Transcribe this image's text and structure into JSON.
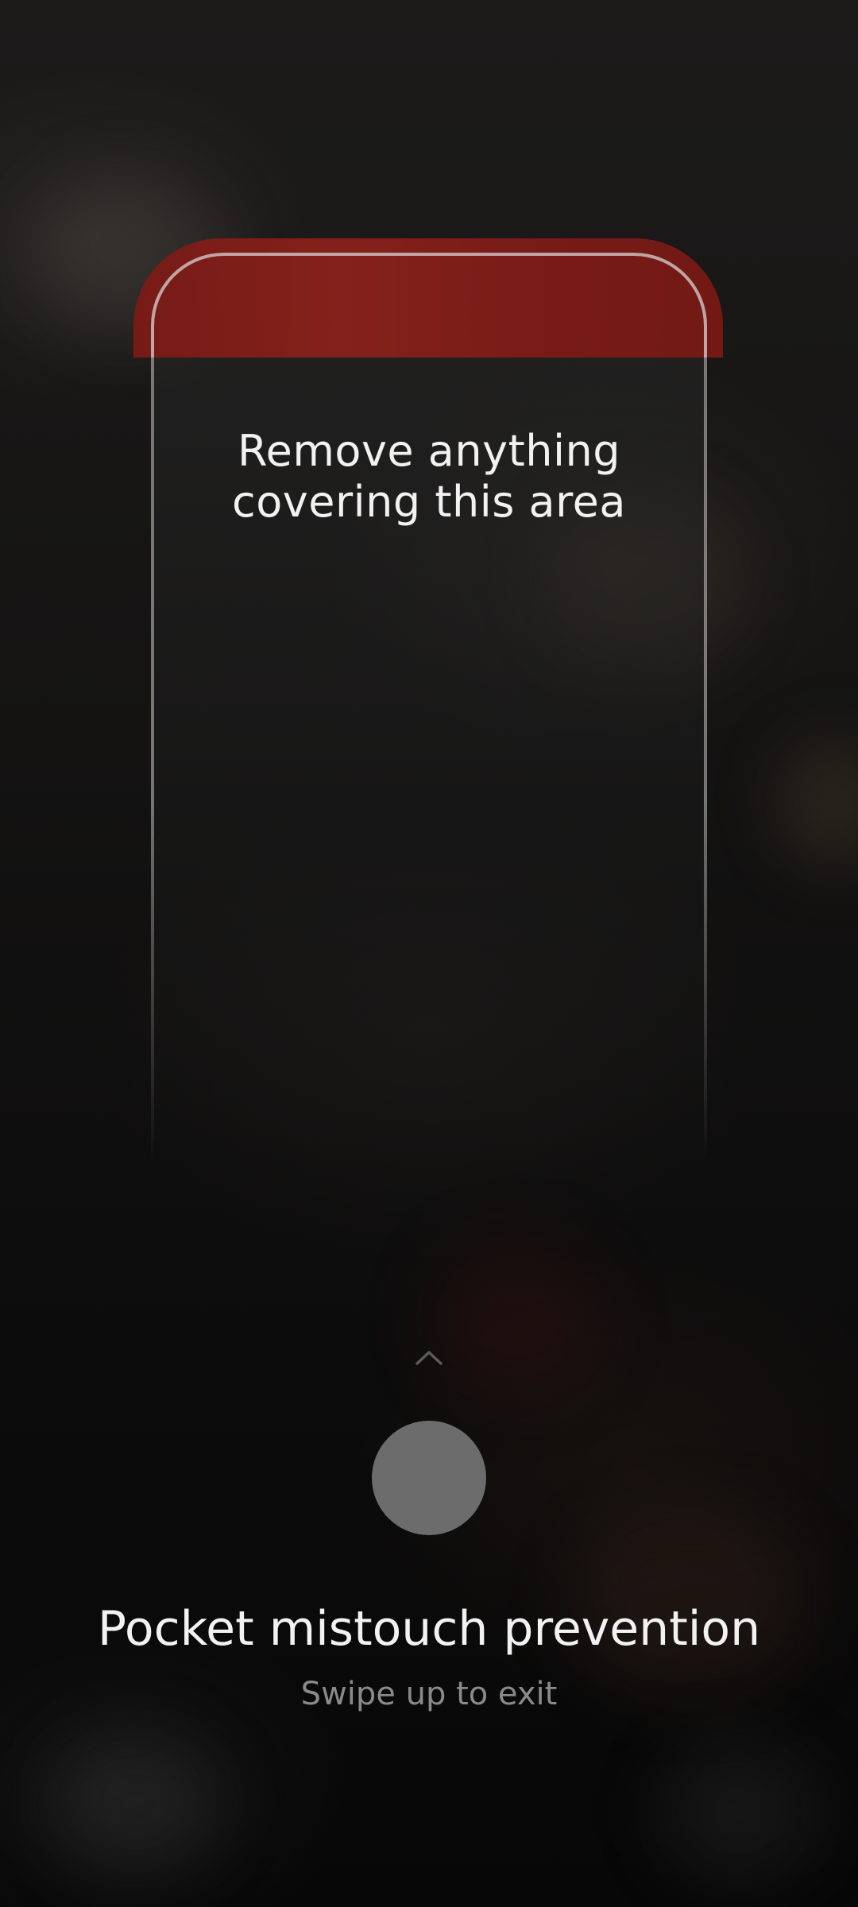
{
  "overlay": {
    "area_message": "Remove anything covering this area",
    "title": "Pocket mistouch prevention",
    "subtitle": "Swipe up to exit"
  },
  "icons": {
    "chevron": "chevron-up-icon",
    "handle": "swipe-handle"
  },
  "colors": {
    "warning_band": "#861f1a",
    "handle": "#6c6c6c",
    "title_text": "#f2f2f2",
    "subtitle_text": "#8a8a8a"
  }
}
